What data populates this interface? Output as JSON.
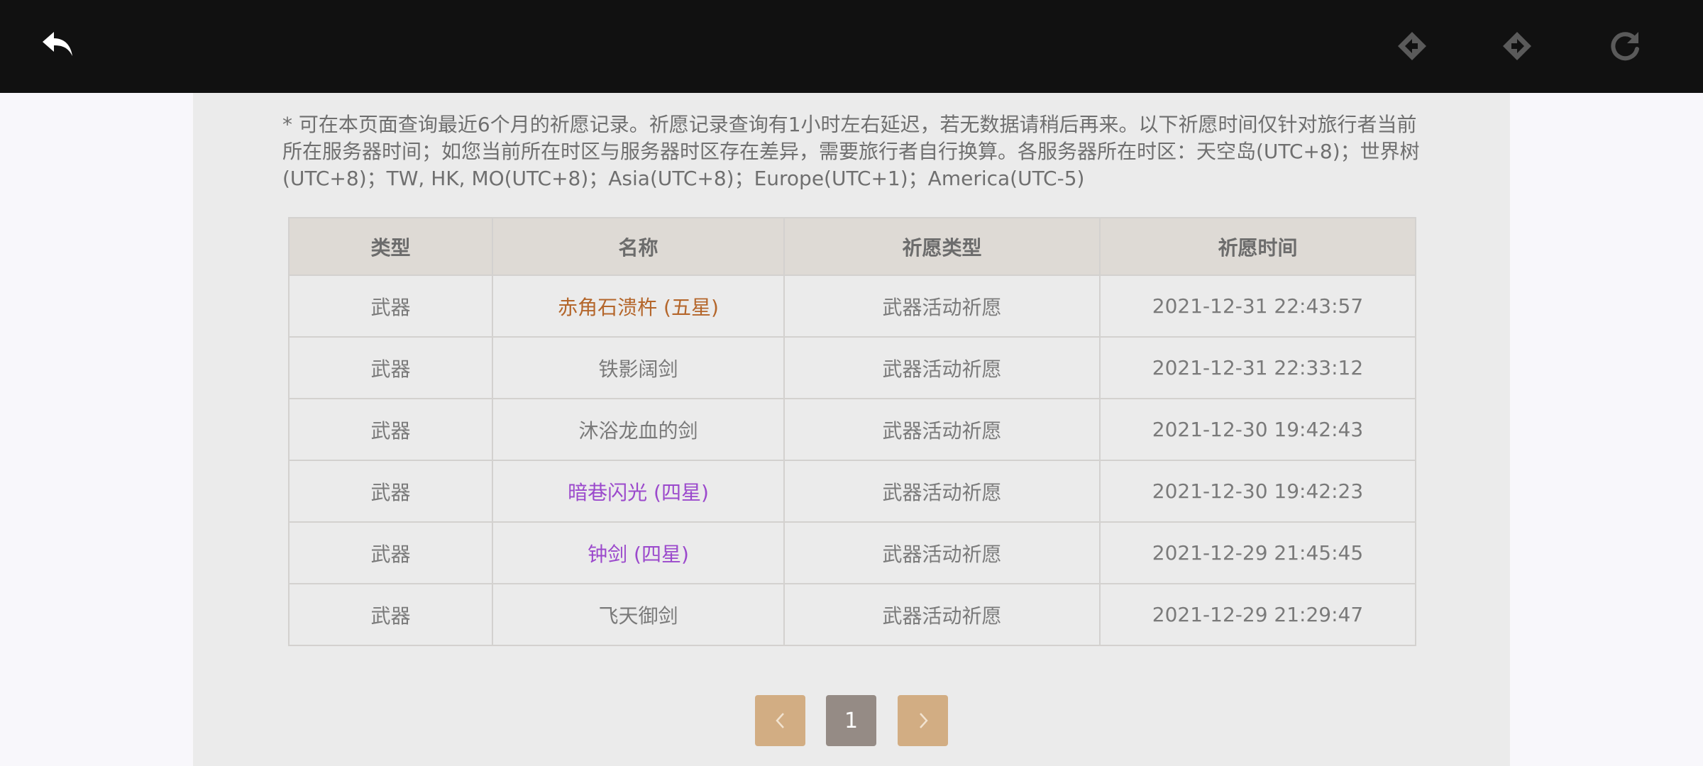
{
  "toolbar": {
    "back_icon": "back-arrow-icon",
    "prev_icon": "diamond-arrow-left-icon",
    "next_icon": "diamond-arrow-right-icon",
    "reload_icon": "reload-icon",
    "colors": {
      "bar": "#111111",
      "active": "#ffffff",
      "disabled": "#5a5a5a"
    }
  },
  "notice": "* 可在本页面查询最近6个月的祈愿记录。祈愿记录查询有1小时左右延迟，若无数据请稍后再来。以下祈愿时间仅针对旅行者当前所在服务器时间；如您当前所在时区与服务器时区存在差异，需要旅行者自行换算。各服务器所在时区：天空岛(UTC+8)；世界树(UTC+8)；TW, HK, MO(UTC+8)；Asia(UTC+8)；Europe(UTC+1)；America(UTC-5)",
  "table": {
    "headers": [
      "类型",
      "名称",
      "祈愿类型",
      "祈愿时间"
    ],
    "rows": [
      {
        "type": "武器",
        "name": "赤角石溃杵 (五星)",
        "wish_type": "武器活动祈愿",
        "time": "2021-12-31 22:43:57",
        "rarity": "five"
      },
      {
        "type": "武器",
        "name": "铁影阔剑",
        "wish_type": "武器活动祈愿",
        "time": "2021-12-31 22:33:12",
        "rarity": "three"
      },
      {
        "type": "武器",
        "name": "沐浴龙血的剑",
        "wish_type": "武器活动祈愿",
        "time": "2021-12-30 19:42:43",
        "rarity": "three"
      },
      {
        "type": "武器",
        "name": "暗巷闪光 (四星)",
        "wish_type": "武器活动祈愿",
        "time": "2021-12-30 19:42:23",
        "rarity": "four"
      },
      {
        "type": "武器",
        "name": "钟剑 (四星)",
        "wish_type": "武器活动祈愿",
        "time": "2021-12-29 21:45:45",
        "rarity": "four"
      },
      {
        "type": "武器",
        "name": "飞天御剑",
        "wish_type": "武器活动祈愿",
        "time": "2021-12-29 21:29:47",
        "rarity": "three"
      }
    ],
    "rarity_colors": {
      "five": "#b4662b",
      "four": "#9b49cc",
      "three": "#7a7a7a"
    }
  },
  "pagination": {
    "prev_label": "‹",
    "current_page": "1",
    "next_label": "›"
  }
}
